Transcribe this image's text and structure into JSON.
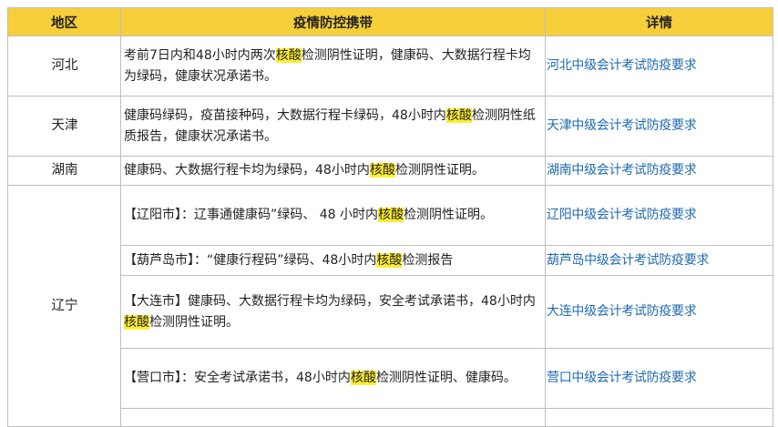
{
  "headers": {
    "region": "地区",
    "requirements": "疫情防控携带",
    "details": "详情"
  },
  "highlight_color": "#ffee33",
  "header_color": "#f6cf3a",
  "link_color": "#1f6bb0",
  "rows": [
    {
      "region": "河北",
      "req": {
        "a": "考前7日内和48小时内两次",
        "hl": "核酸",
        "b": "检测阴性证明，健康码、大数据行程卡均为绿码，健康状况承诺书。"
      },
      "link": "河北中级会计考试防疫要求"
    },
    {
      "region": "天津",
      "req": {
        "a": "健康码绿码，疫苗接种码，大数据行程卡绿码，48小时内",
        "hl": "核酸",
        "b": "检测阴性纸质报告，健康状况承诺书。"
      },
      "link": "天津中级会计考试防疫要求"
    },
    {
      "region": "湖南",
      "req": {
        "a": "健康码、大数据行程卡均为绿码，48小时内",
        "hl": "核酸",
        "b": "检测阴性证明。"
      },
      "link": "湖南中级会计考试防疫要求"
    }
  ],
  "liaoning": {
    "region": "辽宁",
    "cities": [
      {
        "req": {
          "a": "【辽阳市】：辽事通健康码”绿码、 48 小时内",
          "hl": "核酸",
          "b": "检测阴性证明。"
        },
        "link": "辽阳中级会计考试防疫要求"
      },
      {
        "req": {
          "a": "【葫芦岛市】：“健康行程码”绿码、48小时内",
          "hl": "核酸",
          "b": "检测报告"
        },
        "link": "葫芦岛中级会计考试防疫要求"
      },
      {
        "req": {
          "a": "【大连市】健康码、大数据行程卡均为绿码，安全考试承诺书，48小时内",
          "hl": "核酸",
          "b": "检测阴性证明。"
        },
        "link": "大连中级会计考试防疫要求"
      },
      {
        "req": {
          "a": "【营口市】：安全考试承诺书，48小时内",
          "hl": "核酸",
          "b": "检测阴性证明、健康码。"
        },
        "link": "营口中级会计考试防疫要求"
      }
    ]
  }
}
